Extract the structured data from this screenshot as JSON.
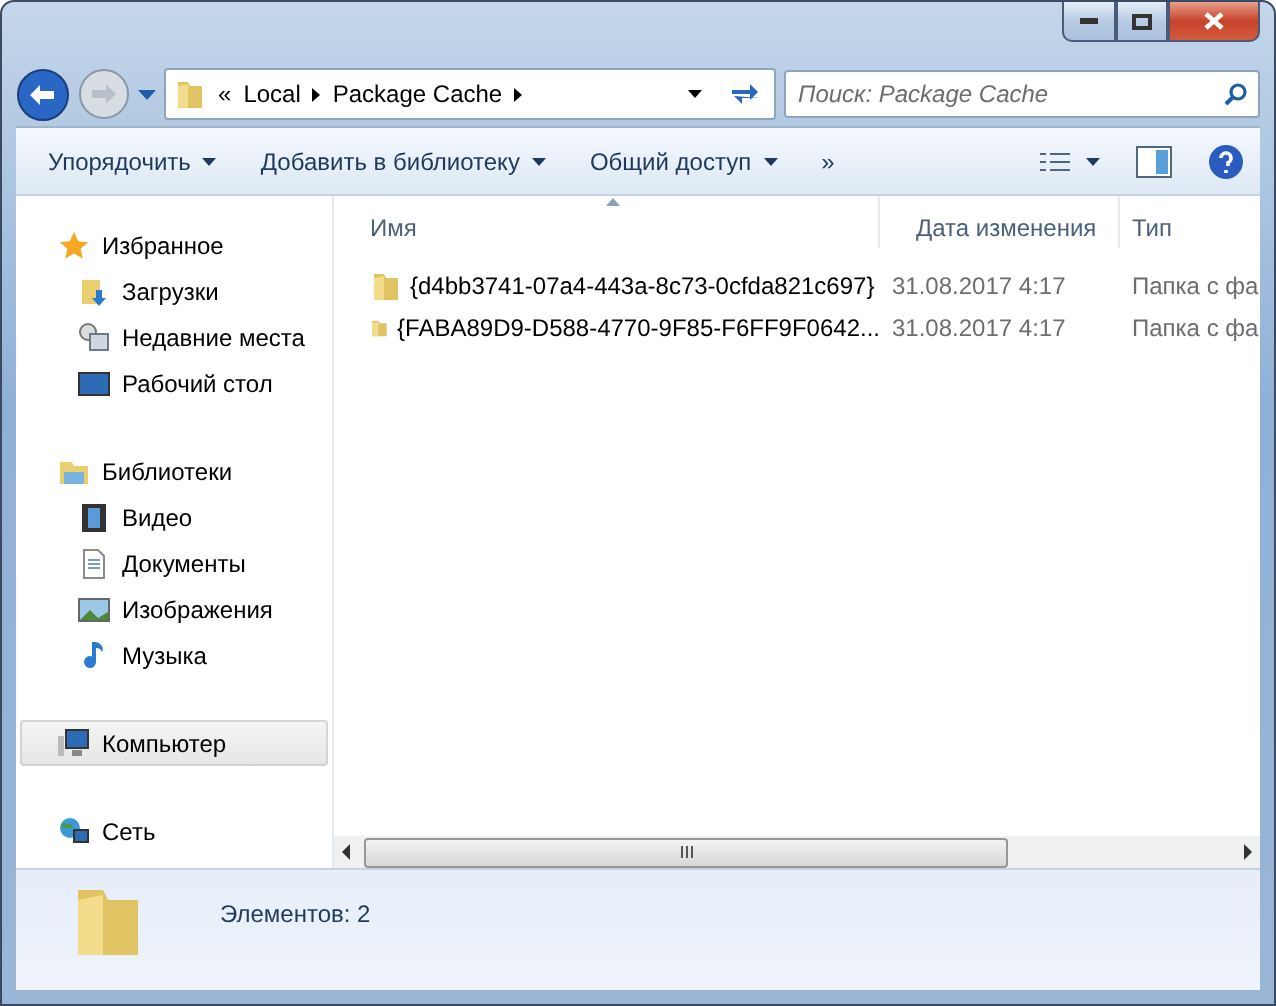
{
  "address": {
    "overflow": "«",
    "crumbs": [
      "Local",
      "Package Cache"
    ]
  },
  "search": {
    "placeholder": "Поиск: Package Cache"
  },
  "toolbar": {
    "items": [
      {
        "label": "Упорядочить"
      },
      {
        "label": "Добавить в библиотеку"
      },
      {
        "label": "Общий доступ"
      }
    ],
    "more": "»"
  },
  "sidebar": {
    "groups": [
      {
        "label": "Избранное",
        "selected": false,
        "children": [
          {
            "label": "Загрузки",
            "selected": false
          },
          {
            "label": "Недавние места",
            "selected": false
          },
          {
            "label": "Рабочий стол",
            "selected": false
          }
        ]
      },
      {
        "label": "Библиотеки",
        "selected": false,
        "children": [
          {
            "label": "Видео",
            "selected": false
          },
          {
            "label": "Документы",
            "selected": false
          },
          {
            "label": "Изображения",
            "selected": false
          },
          {
            "label": "Музыка",
            "selected": false
          }
        ]
      },
      {
        "label": "Компьютер",
        "selected": true
      },
      {
        "label": "Сеть",
        "selected": false
      }
    ]
  },
  "table": {
    "columns": [
      {
        "label": "Имя",
        "sorted": true
      },
      {
        "label": "Дата изменения",
        "sorted": false
      },
      {
        "label": "Тип",
        "sorted": false
      }
    ],
    "rows": [
      {
        "name": "{d4bb3741-07a4-443a-8c73-0cfda821c697}",
        "date": "31.08.2017 4:17",
        "type": "Папка с фа"
      },
      {
        "name": "{FABA89D9-D588-4770-9F85-F6FF9F0642...",
        "date": "31.08.2017 4:17",
        "type": "Папка с фа"
      }
    ]
  },
  "status_bar": {
    "text": "Элементов: 2"
  }
}
